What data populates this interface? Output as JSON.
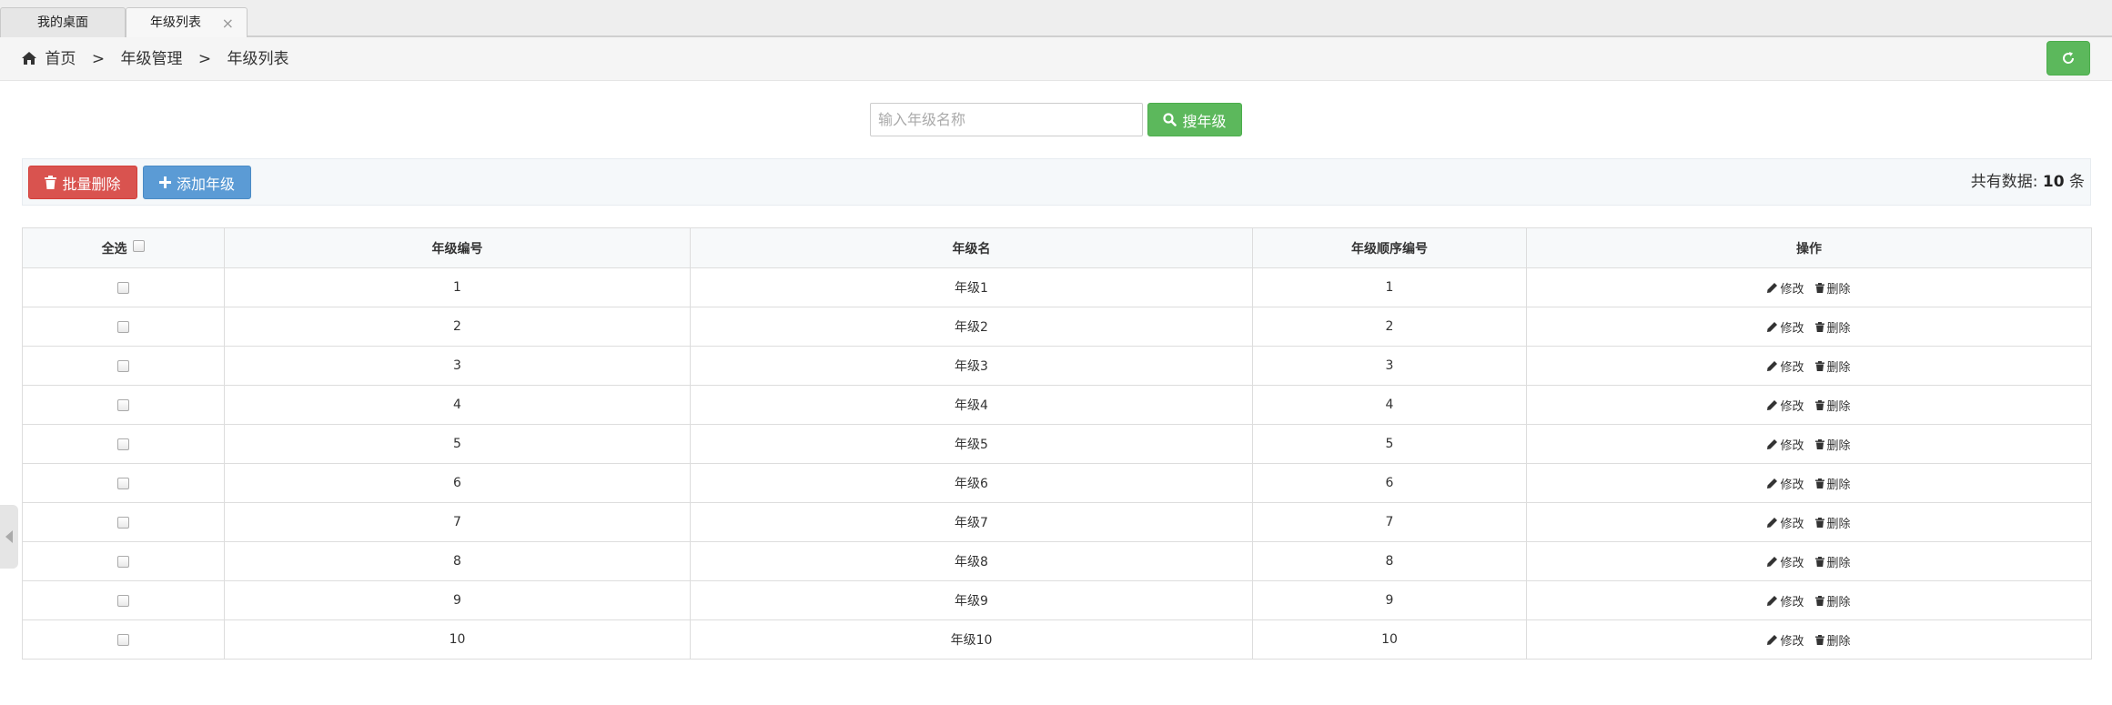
{
  "tabs": [
    {
      "label": "我的桌面"
    },
    {
      "label": "年级列表",
      "close": "×"
    }
  ],
  "breadcrumb": {
    "home": "首页",
    "sep": ">",
    "level2": "年级管理",
    "level3": "年级列表"
  },
  "search": {
    "placeholder": "输入年级名称",
    "value": "",
    "button_label": "搜年级"
  },
  "actions": {
    "batch_delete": "批量删除",
    "add": "添加年级"
  },
  "total": {
    "prefix": "共有数据:",
    "count": "10",
    "suffix": "条"
  },
  "table": {
    "headers": {
      "select_all": "全选",
      "grade_no": "年级编号",
      "grade_name": "年级名",
      "order_no": "年级顺序编号",
      "operations": "操作"
    },
    "edit_label": "修改",
    "delete_label": "删除",
    "rows": [
      {
        "no": "1",
        "name": "年级1",
        "order": "1"
      },
      {
        "no": "2",
        "name": "年级2",
        "order": "2"
      },
      {
        "no": "3",
        "name": "年级3",
        "order": "3"
      },
      {
        "no": "4",
        "name": "年级4",
        "order": "4"
      },
      {
        "no": "5",
        "name": "年级5",
        "order": "5"
      },
      {
        "no": "6",
        "name": "年级6",
        "order": "6"
      },
      {
        "no": "7",
        "name": "年级7",
        "order": "7"
      },
      {
        "no": "8",
        "name": "年级8",
        "order": "8"
      },
      {
        "no": "9",
        "name": "年级9",
        "order": "9"
      },
      {
        "no": "10",
        "name": "年级10",
        "order": "10"
      }
    ]
  },
  "colors": {
    "success": "#5cb85c",
    "danger": "#d9534f",
    "primary": "#5b9bd5"
  },
  "icons": {
    "home": "home-icon",
    "refresh": "refresh-icon",
    "search": "search-icon",
    "trash": "trash-icon",
    "plus": "plus-icon",
    "pencil": "pencil-icon",
    "close": "close-icon",
    "collapse": "chevron-left-icon"
  }
}
